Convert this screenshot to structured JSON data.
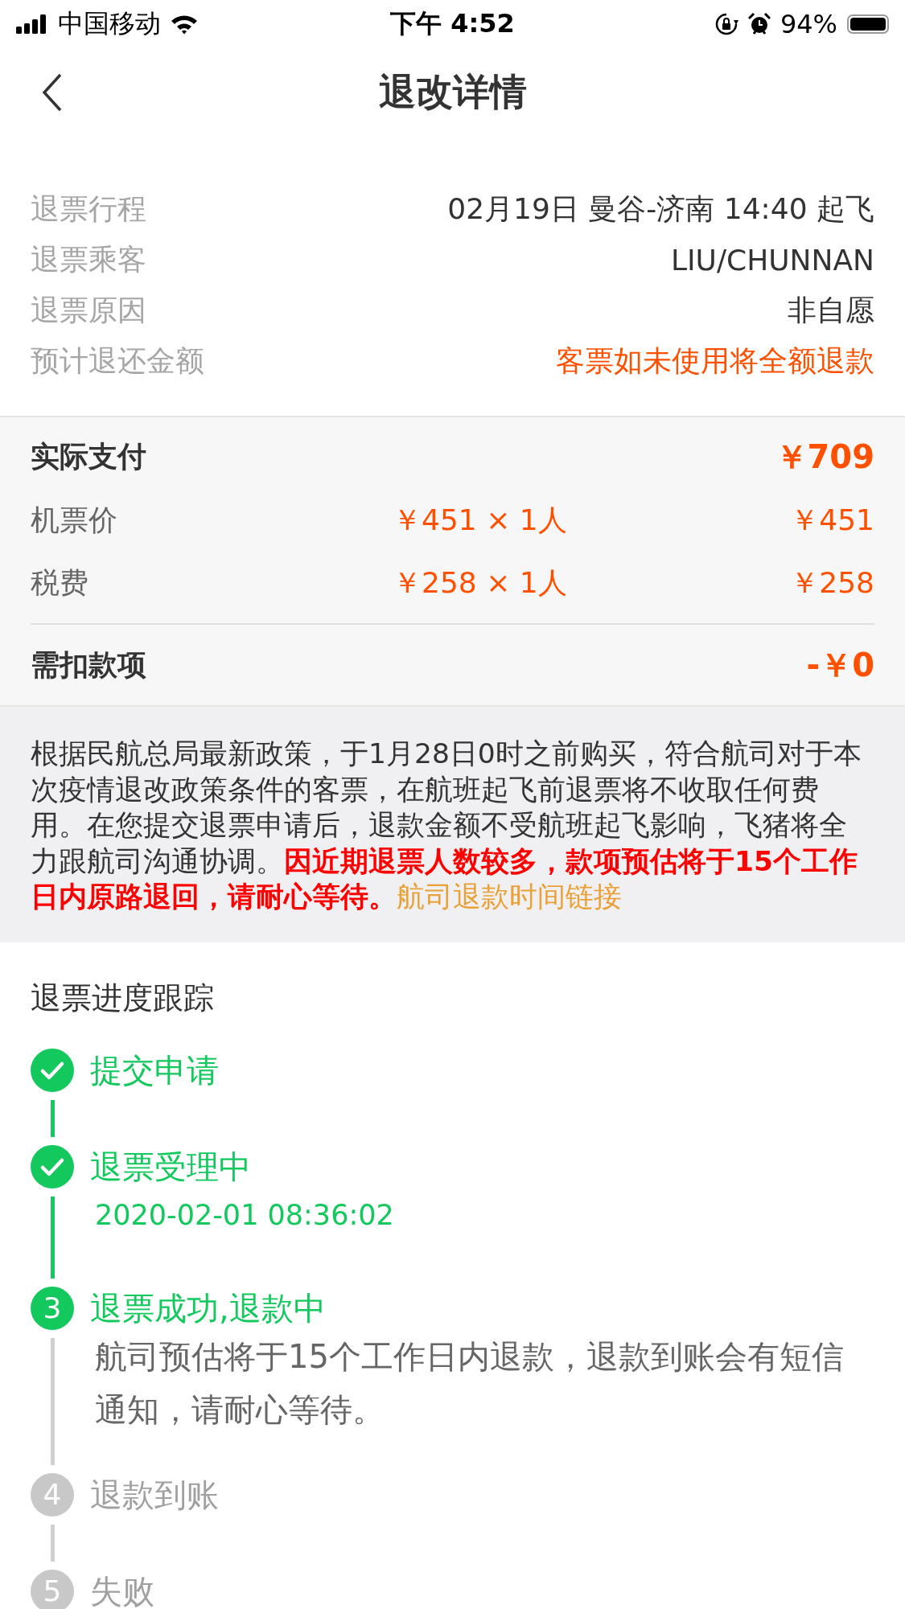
{
  "status_bar": {
    "carrier": "中国移动",
    "time": "下午 4:52",
    "battery": "94%"
  },
  "nav": {
    "title": "退改详情"
  },
  "trip_info": [
    {
      "label": "退票行程",
      "value": "02月19日 曼谷-济南 14:40 起飞",
      "kind": "normal"
    },
    {
      "label": "退票乘客",
      "value": "LIU/CHUNNAN",
      "kind": "normal"
    },
    {
      "label": "退票原因",
      "value": "非自愿",
      "kind": "normal"
    },
    {
      "label": "预计退还金额",
      "value": "客票如未使用将全额退款",
      "kind": "highlight"
    }
  ],
  "payment": {
    "total": {
      "label": "实际支付",
      "amount": "￥709"
    },
    "items": [
      {
        "label": "机票价",
        "unit": "￥451 × 1人",
        "amount": "￥451"
      },
      {
        "label": "税费",
        "unit": "￥258 × 1人",
        "amount": "￥258"
      }
    ],
    "deduction": {
      "label": "需扣款项",
      "amount": "-￥0"
    }
  },
  "notice": {
    "text": "根据民航总局最新政策，于1月28日0时之前购买，符合航司对于本次疫情退改政策条件的客票，在航班起飞前退票将不收取任何费用。在您提交退票申请后，退款金额不受航班起飞影响，飞猪将全力跟航司沟通协调。**因近期退票人数较多，款项预估将于15个工作日内原路退回，请耐心等待。**",
    "link": "航司退款时间链接"
  },
  "progress": {
    "title": "退票进度跟踪",
    "steps": [
      {
        "label": "提交申请",
        "done": true,
        "active": true
      },
      {
        "label": "退票受理中",
        "done": true,
        "active": true,
        "details": [
          {
            "kind": "time",
            "text": "2020-02-01 08:36:02"
          }
        ]
      },
      {
        "number": "3",
        "label": "退票成功,退款中",
        "done": false,
        "active": true,
        "details": [
          {
            "kind": "note",
            "text": "航司预估将于15个工作日内退款，退款到账会有短信通知，请耐心等待。"
          }
        ]
      },
      {
        "number": "4",
        "label": "退款到账",
        "done": false,
        "active": false
      },
      {
        "number": "5",
        "label": "失败",
        "done": false,
        "active": false
      }
    ]
  }
}
